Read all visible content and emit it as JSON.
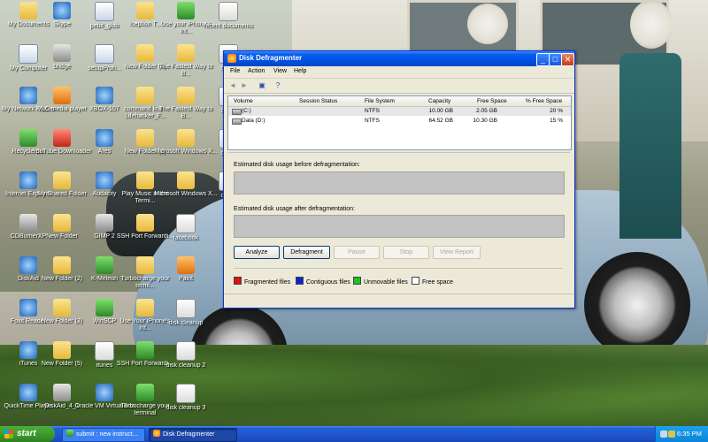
{
  "desktop": {
    "icons": [
      {
        "label": "My Documents"
      },
      {
        "label": "Skype"
      },
      {
        "label": "pebit_glob"
      },
      {
        "label": "Iception T..."
      },
      {
        "label": "Use your iPhone's Int..."
      },
      {
        "label": "recent documents"
      },
      {
        "label": "My Computer"
      },
      {
        "label": "bridge"
      },
      {
        "label": "setupProh..."
      },
      {
        "label": "New Folder (4)"
      },
      {
        "label": "The Fastest Way to B..."
      },
      {
        "label": "doc..."
      },
      {
        "label": "My Network Places"
      },
      {
        "label": "VLC media player"
      },
      {
        "label": "XBOX-107"
      },
      {
        "label": "command line - Lifehacker_F..."
      },
      {
        "label": "The Fastest Way to B..."
      },
      {
        "label": "doc..."
      },
      {
        "label": "Recycle Bin"
      },
      {
        "label": "YouTube Downloader"
      },
      {
        "label": "Ares"
      },
      {
        "label": "New Folder (6)"
      },
      {
        "label": "Microsoft Windows X..."
      },
      {
        "label": "doc..."
      },
      {
        "label": "Internet Explorer"
      },
      {
        "label": "My Shared Folder"
      },
      {
        "label": "Audacity"
      },
      {
        "label": "Play Music in the Termi..."
      },
      {
        "label": "Microsoft Windows X..."
      },
      {
        "label": "doc..."
      },
      {
        "label": "CDBurnerXP"
      },
      {
        "label": "New Folder"
      },
      {
        "label": "GIMP 2"
      },
      {
        "label": "SSH Port Forwardi..."
      },
      {
        "label": "facebook"
      },
      {
        "label": "DiskAid"
      },
      {
        "label": "New Folder (2)"
      },
      {
        "label": "K-Meleon"
      },
      {
        "label": "Turbocharge your termi..."
      },
      {
        "label": "Paint"
      },
      {
        "label": "Foxit Reader"
      },
      {
        "label": "New Folder (3)"
      },
      {
        "label": "WinSCP"
      },
      {
        "label": "Use Your iPhone's Int..."
      },
      {
        "label": "disk cleanup"
      },
      {
        "label": "iTunes"
      },
      {
        "label": "New Folder (5)"
      },
      {
        "label": "itunes"
      },
      {
        "label": "SSH Port Forwardi..."
      },
      {
        "label": "disk cleanup 2"
      },
      {
        "label": "QuickTime Player"
      },
      {
        "label": "DiskAid_4_1"
      },
      {
        "label": "Oracle VM VirtualBox"
      },
      {
        "label": "Turbocharge your terminal"
      },
      {
        "label": "disk cleanup 3"
      }
    ]
  },
  "window": {
    "title": "Disk Defragmenter",
    "buttons": {
      "minimize": "_",
      "maximize": "□",
      "close": "✕"
    },
    "menu": [
      "File",
      "Action",
      "View",
      "Help"
    ],
    "toolbar": [
      "back",
      "forward",
      "properties",
      "help"
    ],
    "columns": [
      "Volume",
      "Session Status",
      "File System",
      "Capacity",
      "Free Space",
      "% Free Space"
    ],
    "rows": [
      {
        "volume": "(C:)",
        "status": "",
        "fs": "NTFS",
        "capacity": "10.00 GB",
        "free": "2.05 GB",
        "pct": "20 %"
      },
      {
        "volume": "Data (D:)",
        "status": "",
        "fs": "NTFS",
        "capacity": "64.52 GB",
        "free": "10.30 GB",
        "pct": "15 %"
      }
    ],
    "before_label": "Estimated disk usage before defragmentation:",
    "after_label": "Estimated disk usage after defragmentation:",
    "action_buttons": {
      "analyze": "Analyze",
      "defragment": "Defragment",
      "pause": "Pause",
      "stop": "Stop",
      "view_report": "View Report"
    },
    "legend": [
      {
        "label": "Fragmented files",
        "color": "#e01010"
      },
      {
        "label": "Contiguous files",
        "color": "#1020d8"
      },
      {
        "label": "Unmovable files",
        "color": "#20c020"
      },
      {
        "label": "Free space",
        "color": "#ffffff"
      }
    ]
  },
  "taskbar": {
    "start": "start",
    "tasks": [
      {
        "label": "submit : new instruct..."
      },
      {
        "label": "Disk Defragmenter"
      }
    ],
    "clock": "6:35 PM"
  }
}
